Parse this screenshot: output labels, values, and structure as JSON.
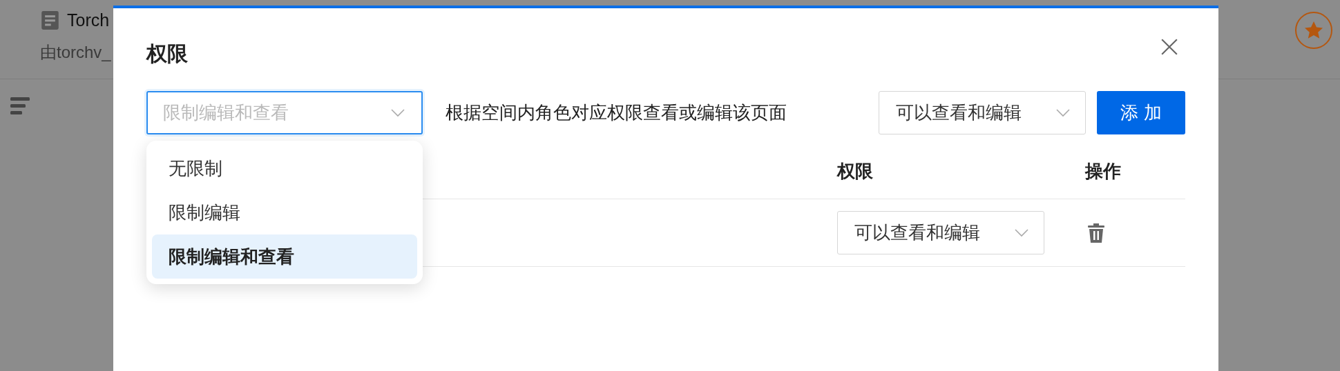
{
  "page": {
    "doc_title": "Torch",
    "author_text": "由torchv_"
  },
  "dialog": {
    "title": "权限",
    "access_select": {
      "value": "限制编辑和查看",
      "open": true
    },
    "access_options": [
      {
        "label": "无限制",
        "selected": false
      },
      {
        "label": "限制编辑",
        "selected": false
      },
      {
        "label": "限制编辑和查看",
        "selected": true
      }
    ],
    "description": "根据空间内角色对应权限查看或编辑该页面",
    "role_select": "可以查看和编辑",
    "add_button": "添 加",
    "table": {
      "columns": [
        "权限",
        "操作"
      ],
      "rows": [
        {
          "permission": "可以查看和编辑"
        }
      ]
    }
  }
}
